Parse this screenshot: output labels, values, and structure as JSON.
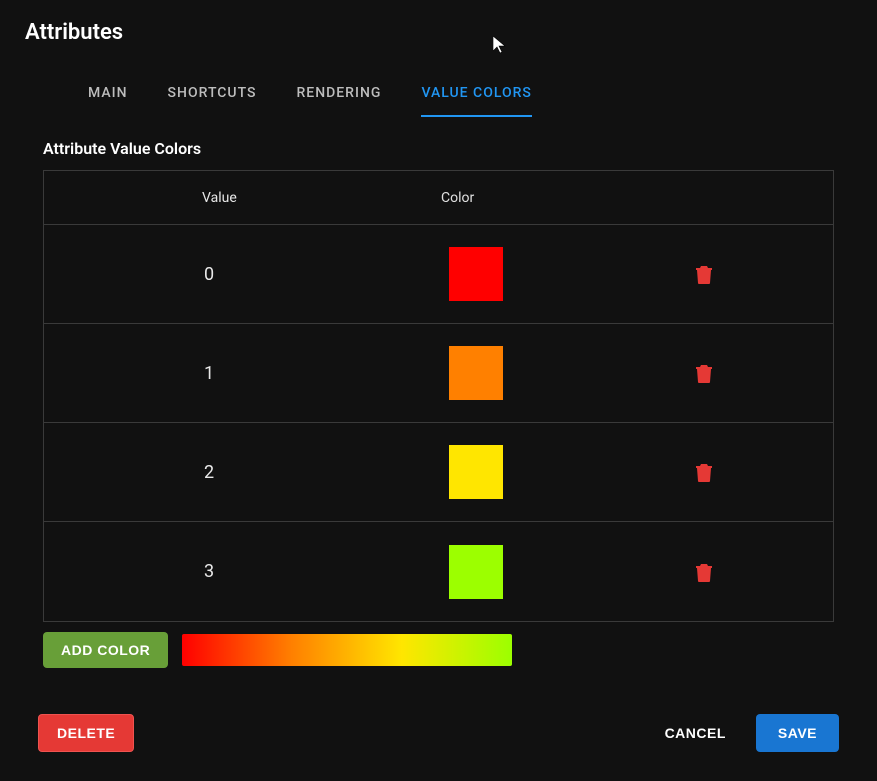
{
  "header": {
    "title": "Attributes"
  },
  "tabs": {
    "main": "MAIN",
    "shortcuts": "SHORTCUTS",
    "rendering": "RENDERING",
    "value_colors": "VALUE COLORS",
    "active": "value_colors"
  },
  "section": {
    "title": "Attribute Value Colors"
  },
  "table": {
    "headers": {
      "value": "Value",
      "color": "Color"
    },
    "rows": [
      {
        "value": "0",
        "color": "#ff0000"
      },
      {
        "value": "1",
        "color": "#ff8000"
      },
      {
        "value": "2",
        "color": "#ffe600"
      },
      {
        "value": "3",
        "color": "#9cff00"
      }
    ]
  },
  "buttons": {
    "add_color": "ADD COLOR",
    "delete": "DELETE",
    "cancel": "CANCEL",
    "save": "SAVE"
  },
  "gradient": {
    "stops": [
      "#ff0000",
      "#ff8000",
      "#ffe600",
      "#9cff00"
    ]
  },
  "icons": {
    "trash_color": "#e53935"
  }
}
